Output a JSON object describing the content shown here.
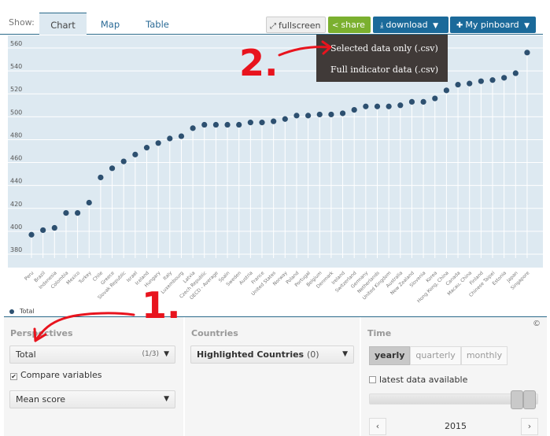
{
  "header": {
    "show_label": "Show:",
    "tabs": [
      {
        "label": "Chart",
        "active": true
      },
      {
        "label": "Map",
        "active": false
      },
      {
        "label": "Table",
        "active": false
      }
    ],
    "buttons": {
      "fullscreen": "fullscreen",
      "share": "share",
      "download": "download",
      "pinboard": "My pinboard"
    },
    "icons": {
      "fullscreen": "expand-arrows-icon",
      "share": "share-icon",
      "download": "download-icon",
      "pinboard": "pin-icon",
      "caret": "▼"
    }
  },
  "download_menu": {
    "items": [
      "Selected data only (.csv)",
      "Full indicator data (.csv)"
    ]
  },
  "annotations": {
    "one": "1.",
    "two": "2."
  },
  "colors": {
    "plot_bg": "#dde9f1",
    "point": "#2d5070",
    "share_green": "#7bb02f",
    "primary_blue": "#1b6a9a",
    "menu_bg": "#403a38",
    "annotation_red": "#e8141e"
  },
  "legend": {
    "label": "Total"
  },
  "controls": {
    "perspectives": {
      "label": "Perspectives",
      "selected": "Total",
      "count": "(1/3)",
      "compare_label": "Compare variables",
      "compare_checked": true,
      "variable": "Mean score"
    },
    "countries": {
      "label": "Countries",
      "selected": "Highlighted Countries",
      "count": "(0)"
    },
    "time": {
      "label": "Time",
      "modes": [
        {
          "label": "yearly",
          "active": true
        },
        {
          "label": "quarterly",
          "active": false
        },
        {
          "label": "monthly",
          "active": false
        }
      ],
      "latest_label": "latest data available",
      "latest_checked": false,
      "year": "2015",
      "prev": "‹",
      "next": "›",
      "copyright": "©"
    }
  },
  "chart_data": {
    "type": "scatter",
    "title": "",
    "xlabel": "",
    "ylabel": "",
    "ylim": [
      380,
      560
    ],
    "yticks": [
      380,
      400,
      420,
      440,
      460,
      480,
      500,
      520,
      540,
      560
    ],
    "grid": true,
    "legend": "bottom-left",
    "categories": [
      "Peru",
      "Brazil",
      "Indonesia",
      "Colombia",
      "Mexico",
      "Turkey",
      "Chile",
      "Greece",
      "Slovak Republic",
      "Israel",
      "Iceland",
      "Hungary",
      "Italy",
      "Luxembourg",
      "Latvia",
      "Czech Republic",
      "OECD - Average",
      "Spain",
      "Sweden",
      "Austria",
      "France",
      "United States",
      "Norway",
      "Poland",
      "Portugal",
      "Belgium",
      "Denmark",
      "Ireland",
      "Switzerland",
      "Germany",
      "Netherlands",
      "United Kingdom",
      "Australia",
      "New Zealand",
      "Slovenia",
      "Korea",
      "Hong Kong, China",
      "Canada",
      "Macau, China",
      "Finland",
      "Chinese Taipei",
      "Estonia",
      "Japan",
      "Singapore"
    ],
    "series": [
      {
        "name": "Total",
        "values": [
          397,
          401,
          403,
          416,
          416,
          425,
          447,
          455,
          461,
          467,
          473,
          477,
          481,
          483,
          490,
          493,
          493,
          493,
          493,
          495,
          495,
          496,
          498,
          501,
          501,
          502,
          502,
          503,
          506,
          509,
          509,
          509,
          510,
          513,
          513,
          516,
          523,
          528,
          529,
          531,
          532,
          534,
          538,
          556
        ]
      }
    ]
  }
}
